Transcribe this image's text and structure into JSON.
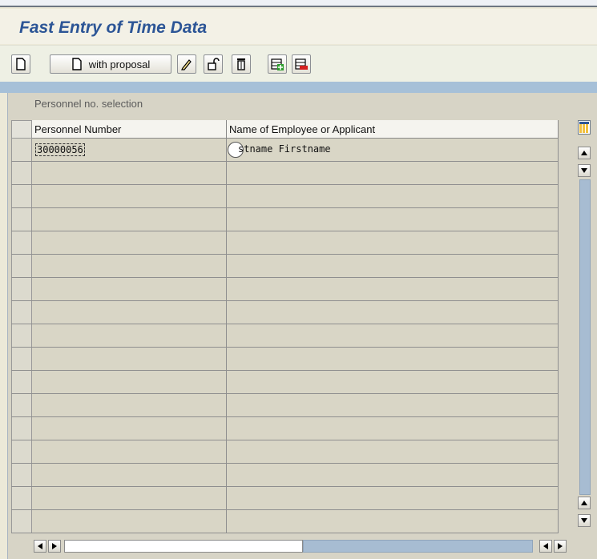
{
  "page": {
    "title": "Fast Entry of Time Data"
  },
  "toolbar": {
    "new_label": "",
    "with_proposal_label": "with proposal"
  },
  "table": {
    "title": "Personnel no. selection",
    "columns": [
      "Personnel Number",
      "Name of Employee or Applicant"
    ],
    "rows": [
      {
        "personnel_number": "30000056",
        "name": "stname Firstname"
      },
      {
        "personnel_number": "",
        "name": ""
      },
      {
        "personnel_number": "",
        "name": ""
      },
      {
        "personnel_number": "",
        "name": ""
      },
      {
        "personnel_number": "",
        "name": ""
      },
      {
        "personnel_number": "",
        "name": ""
      },
      {
        "personnel_number": "",
        "name": ""
      },
      {
        "personnel_number": "",
        "name": ""
      },
      {
        "personnel_number": "",
        "name": ""
      },
      {
        "personnel_number": "",
        "name": ""
      },
      {
        "personnel_number": "",
        "name": ""
      },
      {
        "personnel_number": "",
        "name": ""
      },
      {
        "personnel_number": "",
        "name": ""
      },
      {
        "personnel_number": "",
        "name": ""
      },
      {
        "personnel_number": "",
        "name": ""
      },
      {
        "personnel_number": "",
        "name": ""
      },
      {
        "personnel_number": "",
        "name": ""
      }
    ]
  },
  "colors": {
    "title": "#2c5596",
    "band": "#a6c0d8",
    "table_bg": "#d9d6c6"
  },
  "icons": [
    "new-document-icon",
    "pencil-icon",
    "unlock-icon",
    "trash-icon",
    "add-row-icon",
    "delete-row-icon",
    "column-settings-icon"
  ]
}
